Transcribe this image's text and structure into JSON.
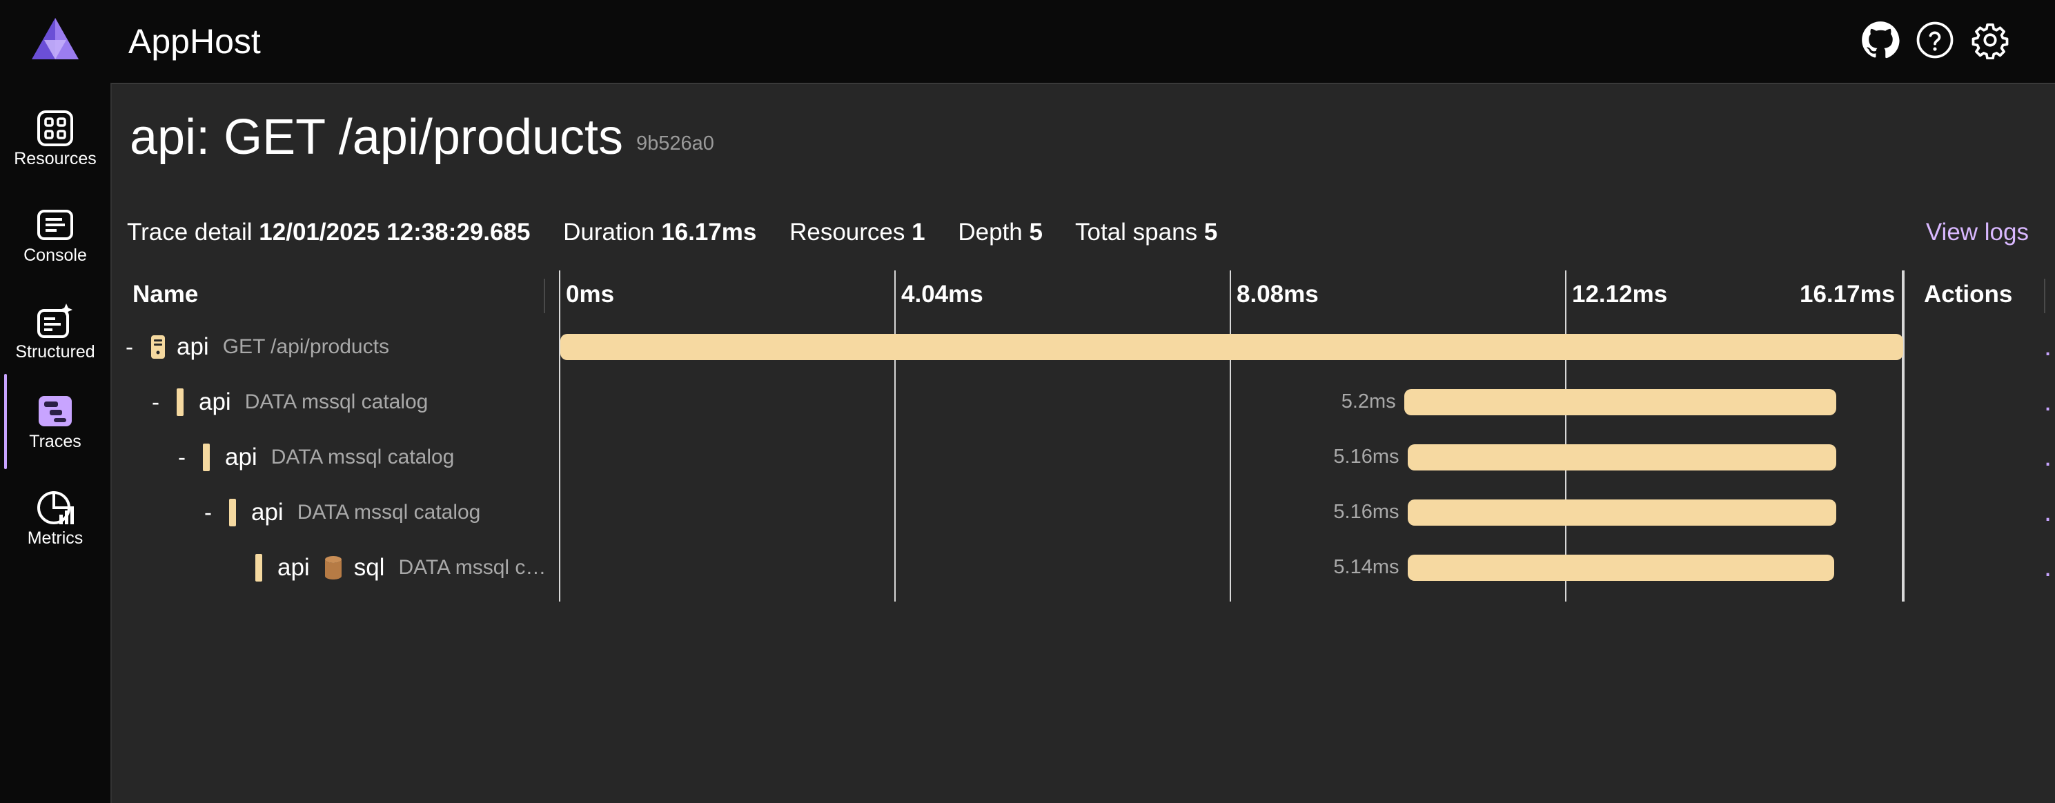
{
  "app": {
    "title": "AppHost"
  },
  "sidebar": {
    "items": [
      {
        "label": "Resources",
        "icon": "resources-icon"
      },
      {
        "label": "Console",
        "icon": "console-icon"
      },
      {
        "label": "Structured",
        "icon": "structured-icon"
      },
      {
        "label": "Traces",
        "icon": "traces-icon",
        "active": true
      },
      {
        "label": "Metrics",
        "icon": "metrics-icon"
      }
    ]
  },
  "header_icons": [
    "github-icon",
    "help-icon",
    "settings-icon"
  ],
  "page": {
    "title": "api: GET /api/products",
    "trace_id": "9b526a0"
  },
  "summary": {
    "trace_detail_label": "Trace detail",
    "trace_detail_value": "12/01/2025 12:38:29.685",
    "duration_label": "Duration",
    "duration_value": "16.17ms",
    "resources_label": "Resources",
    "resources_value": "1",
    "depth_label": "Depth",
    "depth_value": "5",
    "total_spans_label": "Total spans",
    "total_spans_value": "5",
    "view_logs": "View logs"
  },
  "table": {
    "name_header": "Name",
    "actions_header": "Actions",
    "ticks": [
      "0ms",
      "4.04ms",
      "8.08ms",
      "12.12ms",
      "16.17ms"
    ],
    "total_ms": 16.17,
    "rows": [
      {
        "collapse": "-",
        "service": "api",
        "operation": "GET /api/products",
        "start_ms": 0,
        "end_ms": 16.17,
        "duration": "",
        "icon": "server-icon",
        "actions": "..."
      },
      {
        "collapse": "-",
        "service": "api",
        "operation": "DATA mssql catalog",
        "start_ms": 10.16,
        "end_ms": 15.36,
        "duration": "5.2ms",
        "actions": "..."
      },
      {
        "collapse": "-",
        "service": "api",
        "operation": "DATA mssql catalog",
        "start_ms": 10.2,
        "end_ms": 15.36,
        "duration": "5.16ms",
        "actions": "..."
      },
      {
        "collapse": "-",
        "service": "api",
        "operation": "DATA mssql catalog",
        "start_ms": 10.2,
        "end_ms": 15.36,
        "duration": "5.16ms",
        "actions": "..."
      },
      {
        "collapse": "",
        "service": "api",
        "peer": "sql",
        "operation": "DATA mssql c…",
        "start_ms": 10.2,
        "end_ms": 15.34,
        "duration": "5.14ms",
        "icon": "database-icon",
        "actions": "..."
      }
    ]
  },
  "colors": {
    "accent": "#c8a4ff",
    "span_bar": "#f6d9a1",
    "background": "#272727"
  }
}
